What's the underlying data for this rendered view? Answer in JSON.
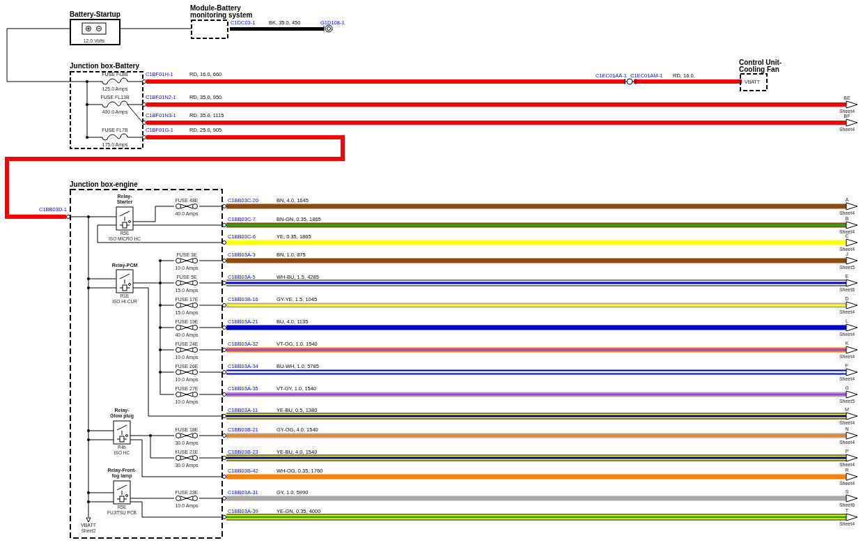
{
  "battery": {
    "title": "Battery-Startup",
    "rating": "12.0 Volts"
  },
  "module": {
    "title": [
      "Module-Battery",
      "monitoring system"
    ],
    "connector": "C1DC03-1",
    "spec": "BK, 35.0, 450",
    "color": "#000000",
    "ground": "G1D108-1"
  },
  "jb_battery": {
    "title": "Junction box-Battery",
    "fuses": [
      {
        "name": "FUSE FL8B",
        "rating": "125.0 Amps"
      },
      {
        "name": "FUSE FL13B",
        "rating": "400.0 Amps"
      },
      {
        "name": "FUSE FL7B",
        "rating": "175.0 Amps"
      }
    ],
    "wires": [
      {
        "connector": "C1BF01H-1",
        "spec": "RD, 16.0, 660",
        "color": "#ff0000"
      },
      {
        "connector": "C1BF01N2-1",
        "spec": "RD, 35.0, 950",
        "color": "#ff0000",
        "tag": "BE",
        "sheet": "Sheet4"
      },
      {
        "connector": "C1BF01N3-1",
        "spec": "RD, 35.0, 1115",
        "color": "#ff0000",
        "tag": "BF",
        "sheet": "Sheet4"
      },
      {
        "connector": "C1BF01G-1",
        "spec": "RD, 25.0, 905",
        "color": "#ff0000"
      }
    ]
  },
  "splice": {
    "left": "C1EC01AA-1",
    "right": "C1EC01AM-1",
    "spec": "RD, 16.0,"
  },
  "control_unit": {
    "title": [
      "Control Unit-",
      "Cooling Fan"
    ],
    "pin": "VBATT"
  },
  "jb_engine": {
    "title": "Junction box-engine",
    "input": "C1BB03D-1",
    "relays": [
      {
        "title": [
          "Relay-",
          "Starter"
        ],
        "code": "R5E",
        "type": "ISO MICRO HC"
      },
      {
        "title": [
          "Relay-PCM"
        ],
        "code": "R1E",
        "type": "ISO HI-CUR"
      },
      {
        "title": [
          "Relay-",
          "Glow plug"
        ],
        "code": "R4b",
        "type": "ISO HC"
      },
      {
        "title": [
          "Relay-Front-",
          "fog lamp"
        ],
        "code": "R5E",
        "type": "FUJITSU PCB"
      }
    ],
    "fuses": [
      {
        "name": "FUSE 48E",
        "rating": "40.0 Amps"
      },
      {
        "name": "FUSE 3E",
        "rating": "10.0 Amps"
      },
      {
        "name": "FUSE 5E",
        "rating": "15.0 Amps"
      },
      {
        "name": "FUSE 17E",
        "rating": "15.0 Amps"
      },
      {
        "name": "FUSE 19E",
        "rating": "40.0 Amps"
      },
      {
        "name": "FUSE 24E",
        "rating": "10.0 Amps"
      },
      {
        "name": "FUSE 26E",
        "rating": "10.0 Amps"
      },
      {
        "name": "FUSE 27E",
        "rating": "10.0 Amps"
      },
      {
        "name": "FUSE 18E",
        "rating": "30.0 Amps"
      },
      {
        "name": "FUSE 21E",
        "rating": "30.0 Amps"
      },
      {
        "name": "FUSE 23E",
        "rating": "10.0 Amps"
      }
    ],
    "wires": [
      {
        "connector": "C1BB03C-20",
        "spec": "BN, 4.0, 1645",
        "bands": [
          {
            "color": "#8b4a0e"
          }
        ],
        "outlined": false,
        "tag": "A",
        "sheet": "Sheet4"
      },
      {
        "connector": "C1BB03C-7",
        "spec": "BN-GN, 0.35, 1865",
        "bands": [
          {
            "color": "#8b4a0e"
          },
          {
            "color": "#22aa00"
          }
        ],
        "outlined": false,
        "tag": "B",
        "sheet": "Sheet4"
      },
      {
        "connector": "C1BB03C-6",
        "spec": "YE, 0.35, 1865",
        "bands": [
          {
            "color": "#ffff00"
          }
        ],
        "outlined": false,
        "tag": "C",
        "sheet": "Sheet4"
      },
      {
        "connector": "C1BB03A-3",
        "spec": "BN, 1.0, 875",
        "bands": [
          {
            "color": "#8b4a0e"
          }
        ],
        "outlined": false,
        "tag": "J",
        "sheet": "Sheet5"
      },
      {
        "connector": "C1BB03A-5",
        "spec": "WH-BU, 1.5, 4285",
        "bands": [
          {
            "color": "#f4f4f4"
          },
          {
            "color": "#0000cc"
          }
        ],
        "outlined": true,
        "tag": "E",
        "sheet": "Sheet6"
      },
      {
        "connector": "C1BB03B-16",
        "spec": "GY-YE, 1.5, 1045",
        "bands": [
          {
            "color": "#aaaaaa"
          },
          {
            "color": "#ffff00"
          }
        ],
        "outlined": false,
        "tag": "D",
        "sheet": "Sheet4"
      },
      {
        "connector": "C1BB03A-21",
        "spec": "BU, 4.0, 1135",
        "bands": [
          {
            "color": "#0000cc"
          }
        ],
        "outlined": false,
        "tag": "L",
        "sheet": "Sheet4"
      },
      {
        "connector": "C1BB03A-32",
        "spec": "VT-OG, 1.0, 1540",
        "bands": [
          {
            "color": "#ff8000"
          },
          {
            "color": "#a040e0"
          }
        ],
        "outlined": false,
        "tag": "K",
        "sheet": "Sheet4"
      },
      {
        "connector": "C1BB03A-34",
        "spec": "BU-WH, 1.0, 5785",
        "bands": [
          {
            "color": "#0000cc"
          },
          {
            "color": "#f4f4f4"
          }
        ],
        "outlined": false,
        "tag": "F",
        "sheet": "Sheet4"
      },
      {
        "connector": "C1BB03A-35",
        "spec": "VT-GY, 1.0, 1540",
        "bands": [
          {
            "color": "#aaaaaa"
          },
          {
            "color": "#a040e0"
          }
        ],
        "outlined": false,
        "tag": "G",
        "sheet": "Sheet5"
      },
      {
        "connector": "C1BB03A-11",
        "spec": "YE-BU, 0.5, 1380",
        "bands": [
          {
            "color": "#ffff00"
          },
          {
            "color": "#0000cc"
          }
        ],
        "outlined": true,
        "tag": "M",
        "sheet": "Sheet4"
      },
      {
        "connector": "C1BB03B-21",
        "spec": "GY-OG, 4.0, 1540",
        "bands": [
          {
            "color": "#aaaaaa"
          },
          {
            "color": "#ff8000"
          }
        ],
        "outlined": false,
        "tag": "N",
        "sheet": "Sheet4"
      },
      {
        "connector": "C1BB03B-23",
        "spec": "YE-BU, 4.0, 1540",
        "bands": [
          {
            "color": "#ffff00"
          },
          {
            "color": "#0000cc"
          }
        ],
        "outlined": true,
        "tag": "P",
        "sheet": "Sheet4"
      },
      {
        "connector": "C1BB03B-42",
        "spec": "WH-OG, 0.35, 1760",
        "bands": [
          {
            "color": "#ff8000"
          }
        ],
        "outlined": false,
        "tag": "R",
        "sheet": "Sheet4"
      },
      {
        "connector": "C1BB03A-31",
        "spec": "GY, 1.0, 5990",
        "bands": [
          {
            "color": "#aaaaaa"
          }
        ],
        "outlined": false,
        "tag": "S",
        "sheet": "Sheet6"
      },
      {
        "connector": "C1BB03A-39",
        "spec": "YE-GN, 0.35, 4000",
        "bands": [
          {
            "color": "#ffff00"
          },
          {
            "color": "#22aa00"
          }
        ],
        "outlined": true,
        "tag": "T",
        "sheet": "Sheet4"
      }
    ],
    "vbatt": {
      "label": "VBATT",
      "sheet": "Sheet2"
    }
  }
}
